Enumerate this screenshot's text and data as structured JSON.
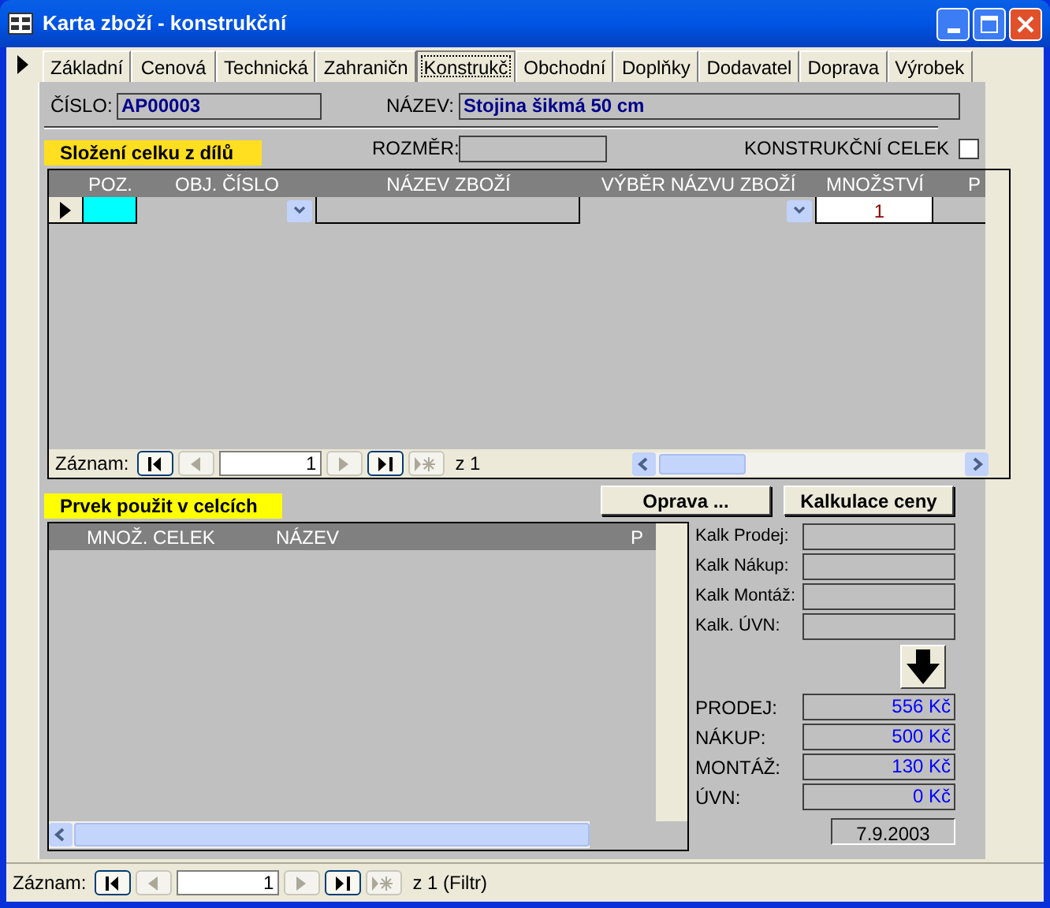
{
  "window": {
    "title": "Karta zboží - konstrukční"
  },
  "tabs": [
    {
      "label": "Základní",
      "selected": false
    },
    {
      "label": "Cenová",
      "selected": false
    },
    {
      "label": "Technická",
      "selected": false
    },
    {
      "label": "Zahraničn",
      "selected": false
    },
    {
      "label": "Konstrukč",
      "selected": true
    },
    {
      "label": "Obchodní",
      "selected": false
    },
    {
      "label": "Doplňky",
      "selected": false
    },
    {
      "label": "Dodavatel",
      "selected": false
    },
    {
      "label": "Doprava",
      "selected": false
    },
    {
      "label": "Výrobek",
      "selected": false
    }
  ],
  "cislo": {
    "label": "ČÍSLO:",
    "value": "AP00003"
  },
  "nazev": {
    "label": "NÁZEV:",
    "value": "Stojina šikmá 50 cm"
  },
  "rozmer": {
    "label": "ROZMĚR:"
  },
  "konstrukcni_celek": {
    "label": "KONSTRUKČNÍ CELEK",
    "checked": false
  },
  "parts": {
    "title": "Složení celku z dílů",
    "columns": [
      "POZ.",
      "OBJ. ČÍSLO",
      "NÁZEV ZBOŽÍ",
      "VÝBĚR NÁZVU ZBOŽÍ",
      "MNOŽSTVÍ",
      "P"
    ],
    "row": {
      "mnozstvi": "1"
    },
    "navigation": {
      "label": "Záznam:",
      "current": "1",
      "total": "z 1"
    }
  },
  "buttons": [
    "Oprava ...",
    "Kalkulace ceny"
  ],
  "used_in": {
    "title": "Prvek použit v celcích",
    "columns": [
      "MNOŽ. CELEK",
      "NÁZEV",
      "P"
    ]
  },
  "calc_fields": [
    {
      "label": "Kalk Prodej:"
    },
    {
      "label": "Kalk Nákup:"
    },
    {
      "label": "Kalk Montáž:"
    },
    {
      "label": "Kalk. ÚVN:"
    }
  ],
  "totals": [
    {
      "label": "PRODEJ:",
      "value": "556 Kč"
    },
    {
      "label": "NÁKUP:",
      "value": "500 Kč"
    },
    {
      "label": "MONTÁŽ:",
      "value": "130 Kč"
    },
    {
      "label": "ÚVN:",
      "value": "0 Kč"
    }
  ],
  "date": "7.9.2003",
  "navigation": {
    "label": "Záznam:",
    "current": "1",
    "total": "z 1 (Filtr)"
  }
}
